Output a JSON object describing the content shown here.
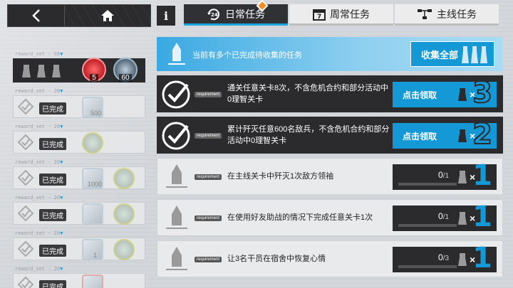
{
  "header": {
    "tabs": [
      {
        "label": "日常任务",
        "icon": "24h-icon",
        "active": true,
        "has_alert": true
      },
      {
        "label": "周常任务",
        "icon": "calendar-7-icon",
        "active": false
      },
      {
        "label": "主线任务",
        "icon": "flowchart-icon",
        "active": false
      }
    ],
    "info_label": "i"
  },
  "rewards": [
    {
      "label": "reward_set - 88",
      "state": "active",
      "items": [
        {
          "count": "5"
        },
        {
          "count": "60"
        }
      ]
    },
    {
      "label": "reward_set - 20",
      "state": "done",
      "done_text": "已完成",
      "count": "500"
    },
    {
      "label": "reward_set - 20",
      "state": "done",
      "done_text": "已完成",
      "count": ""
    },
    {
      "label": "reward_set - 20",
      "state": "done",
      "done_text": "已完成",
      "count": "1000"
    },
    {
      "label": "reward_set - 20",
      "state": "done",
      "done_text": "已完成",
      "count": ""
    },
    {
      "label": "reward_set - 20",
      "state": "done",
      "done_text": "已完成",
      "count": "1"
    },
    {
      "label": "reward_set - 20",
      "state": "done",
      "done_text": "已完成",
      "count": ""
    }
  ],
  "collect": {
    "text": "当前有多个已完成待收集的任务",
    "button_label": "收集全部"
  },
  "tasks": [
    {
      "req": "requirement",
      "desc": "通关任意关卡8次，不含危机合约和部分活动中0理智关卡",
      "state": "ready",
      "button": "点击领取",
      "reward_x": "×",
      "reward_num": "3"
    },
    {
      "req": "requirement",
      "desc": "累计歼灭任意600名敌兵，不含危机合约和部分活动中0理智关卡",
      "state": "ready",
      "button": "点击领取",
      "reward_x": "×",
      "reward_num": "2"
    },
    {
      "req": "requirement",
      "desc": "在主线关卡中歼灭1次敌方领袖",
      "state": "progress",
      "progress": "0",
      "total": "/1",
      "fraction": 0,
      "reward_x": "×",
      "reward_num": "1"
    },
    {
      "req": "requirement",
      "desc": "在使用好友助战的情况下完成任意关卡1次",
      "state": "progress",
      "progress": "0",
      "total": "/1",
      "fraction": 0,
      "reward_x": "×",
      "reward_num": "1"
    },
    {
      "req": "requirement",
      "desc": "让3名干员在宿舍中恢复心情",
      "state": "progress",
      "progress": "0",
      "total": "/3",
      "fraction": 0,
      "reward_x": "×",
      "reward_num": "1"
    }
  ],
  "colors": {
    "accent": "#1599d6",
    "dark": "#2b2b2d",
    "alert": "#ff8a1e"
  }
}
